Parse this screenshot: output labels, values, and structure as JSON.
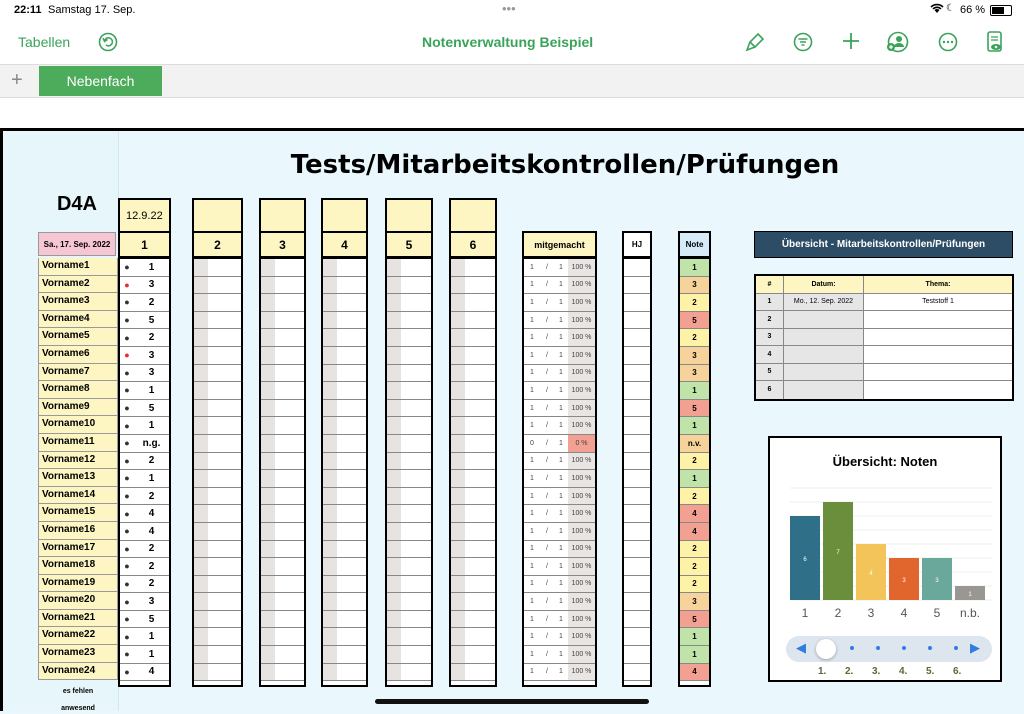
{
  "status": {
    "time": "22:11",
    "date": "Samstag 17. Sep.",
    "battery": "66 %",
    "dots": "•••"
  },
  "toolbar": {
    "tables": "Tabellen",
    "doc_title": "Notenverwaltung  Beispiel"
  },
  "tabs": {
    "active": "Nebenfach"
  },
  "sheet": {
    "title": "Tests/Mitarbeitskontrollen/Prüfungen",
    "class": "D4A",
    "today": "Sa., 17. Sep. 2022",
    "test_date": "12.9.22",
    "col_labels": [
      "1",
      "2",
      "3",
      "4",
      "5",
      "6"
    ],
    "mm_label": "mitgemacht",
    "hj_label": "HJ",
    "note_label": "Note",
    "es_fehlen": "es fehlen",
    "anwesend": "anwesend"
  },
  "students": [
    {
      "name": "Vorname1",
      "grade": "1",
      "dot": "#333",
      "mm": "1",
      "tot": "1",
      "pct": "100 %",
      "note": "1",
      "nc": "#bfe3a8"
    },
    {
      "name": "Vorname2",
      "grade": "3",
      "dot": "#e03030",
      "mm": "1",
      "tot": "1",
      "pct": "100 %",
      "note": "3",
      "nc": "#f6d39a"
    },
    {
      "name": "Vorname3",
      "grade": "2",
      "dot": "#333",
      "mm": "1",
      "tot": "1",
      "pct": "100 %",
      "note": "2",
      "nc": "#fdf2a6"
    },
    {
      "name": "Vorname4",
      "grade": "5",
      "dot": "#333",
      "mm": "1",
      "tot": "1",
      "pct": "100 %",
      "note": "5",
      "nc": "#f2a092"
    },
    {
      "name": "Vorname5",
      "grade": "2",
      "dot": "#333",
      "mm": "1",
      "tot": "1",
      "pct": "100 %",
      "note": "2",
      "nc": "#fdf2a6"
    },
    {
      "name": "Vorname6",
      "grade": "3",
      "dot": "#e03030",
      "mm": "1",
      "tot": "1",
      "pct": "100 %",
      "note": "3",
      "nc": "#f6d39a"
    },
    {
      "name": "Vorname7",
      "grade": "3",
      "dot": "#333",
      "mm": "1",
      "tot": "1",
      "pct": "100 %",
      "note": "3",
      "nc": "#f6d39a"
    },
    {
      "name": "Vorname8",
      "grade": "1",
      "dot": "#333",
      "mm": "1",
      "tot": "1",
      "pct": "100 %",
      "note": "1",
      "nc": "#bfe3a8"
    },
    {
      "name": "Vorname9",
      "grade": "5",
      "dot": "#333",
      "mm": "1",
      "tot": "1",
      "pct": "100 %",
      "note": "5",
      "nc": "#f2a092"
    },
    {
      "name": "Vorname10",
      "grade": "1",
      "dot": "#333",
      "mm": "1",
      "tot": "1",
      "pct": "100 %",
      "note": "1",
      "nc": "#bfe3a8"
    },
    {
      "name": "Vorname11",
      "grade": "n.g.",
      "dot": "#333",
      "mm": "0",
      "tot": "1",
      "pct": "0 %",
      "note": "n.v.",
      "nc": "#f6d39a",
      "pc": "#f2a092"
    },
    {
      "name": "Vorname12",
      "grade": "2",
      "dot": "#333",
      "mm": "1",
      "tot": "1",
      "pct": "100 %",
      "note": "2",
      "nc": "#fdf2a6"
    },
    {
      "name": "Vorname13",
      "grade": "1",
      "dot": "#333",
      "mm": "1",
      "tot": "1",
      "pct": "100 %",
      "note": "1",
      "nc": "#bfe3a8"
    },
    {
      "name": "Vorname14",
      "grade": "2",
      "dot": "#333",
      "mm": "1",
      "tot": "1",
      "pct": "100 %",
      "note": "2",
      "nc": "#fdf2a6"
    },
    {
      "name": "Vorname15",
      "grade": "4",
      "dot": "#333",
      "mm": "1",
      "tot": "1",
      "pct": "100 %",
      "note": "4",
      "nc": "#f2a092"
    },
    {
      "name": "Vorname16",
      "grade": "4",
      "dot": "#333",
      "mm": "1",
      "tot": "1",
      "pct": "100 %",
      "note": "4",
      "nc": "#f2a092"
    },
    {
      "name": "Vorname17",
      "grade": "2",
      "dot": "#333",
      "mm": "1",
      "tot": "1",
      "pct": "100 %",
      "note": "2",
      "nc": "#fdf2a6"
    },
    {
      "name": "Vorname18",
      "grade": "2",
      "dot": "#333",
      "mm": "1",
      "tot": "1",
      "pct": "100 %",
      "note": "2",
      "nc": "#fdf2a6"
    },
    {
      "name": "Vorname19",
      "grade": "2",
      "dot": "#333",
      "mm": "1",
      "tot": "1",
      "pct": "100 %",
      "note": "2",
      "nc": "#fdf2a6"
    },
    {
      "name": "Vorname20",
      "grade": "3",
      "dot": "#333",
      "mm": "1",
      "tot": "1",
      "pct": "100 %",
      "note": "3",
      "nc": "#f6d39a"
    },
    {
      "name": "Vorname21",
      "grade": "5",
      "dot": "#333",
      "mm": "1",
      "tot": "1",
      "pct": "100 %",
      "note": "5",
      "nc": "#f2a092"
    },
    {
      "name": "Vorname22",
      "grade": "1",
      "dot": "#333",
      "mm": "1",
      "tot": "1",
      "pct": "100 %",
      "note": "1",
      "nc": "#bfe3a8"
    },
    {
      "name": "Vorname23",
      "grade": "1",
      "dot": "#333",
      "mm": "1",
      "tot": "1",
      "pct": "100 %",
      "note": "1",
      "nc": "#bfe3a8"
    },
    {
      "name": "Vorname24",
      "grade": "4",
      "dot": "#333",
      "mm": "1",
      "tot": "1",
      "pct": "100 %",
      "note": "4",
      "nc": "#f2a092"
    }
  ],
  "overview": {
    "title": "Übersicht - Mitarbeitskontrollen/Prüfungen",
    "headers": [
      "#",
      "Datum:",
      "Thema:"
    ],
    "rows": [
      {
        "n": "1",
        "date": "Mo., 12. Sep. 2022",
        "topic": "Teststoff 1"
      },
      {
        "n": "2",
        "date": "",
        "topic": ""
      },
      {
        "n": "3",
        "date": "",
        "topic": ""
      },
      {
        "n": "4",
        "date": "",
        "topic": ""
      },
      {
        "n": "5",
        "date": "",
        "topic": ""
      },
      {
        "n": "6",
        "date": "",
        "topic": ""
      }
    ]
  },
  "chart_data": {
    "type": "bar",
    "title": "Übersicht: Noten",
    "categories": [
      "1",
      "2",
      "3",
      "4",
      "5",
      "n.b."
    ],
    "values": [
      6,
      7,
      4,
      3,
      3,
      1
    ],
    "colors": [
      "#2f6f88",
      "#6b8e3c",
      "#f2c45a",
      "#e0662e",
      "#6aa89c",
      "#9a9692"
    ],
    "ylim": [
      0,
      8
    ]
  },
  "slider": {
    "labels": [
      "1.",
      "2.",
      "3.",
      "4.",
      "5.",
      "6."
    ]
  }
}
